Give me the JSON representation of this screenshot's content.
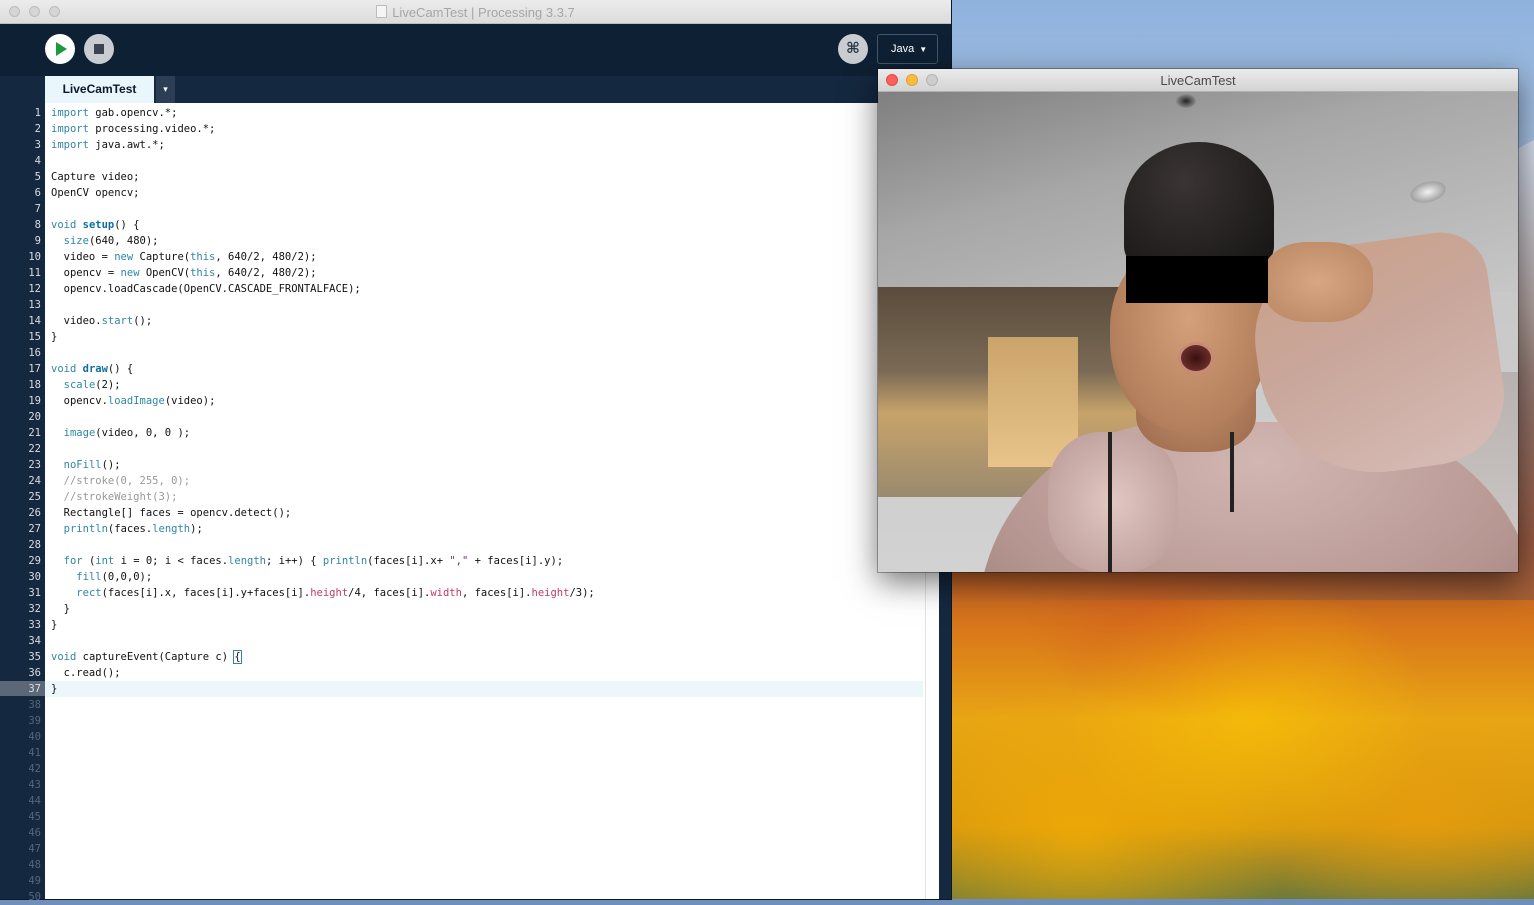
{
  "ide": {
    "window_title": "LiveCamTest | Processing 3.3.7",
    "mode": "Java",
    "debug_glyph": "⌘",
    "tab_label": "LiveCamTest",
    "tab_menu_glyph": "▾",
    "current_line": 37,
    "line_count": 50,
    "code_lines": [
      [
        {
          "t": "import",
          "c": "kw"
        },
        {
          "t": " gab.opencv.*;"
        }
      ],
      [
        {
          "t": "import",
          "c": "kw"
        },
        {
          "t": " processing.video.*;"
        }
      ],
      [
        {
          "t": "import",
          "c": "kw"
        },
        {
          "t": " java.awt.*;"
        }
      ],
      [],
      [
        {
          "t": "Capture video;"
        }
      ],
      [
        {
          "t": "OpenCV opencv;"
        }
      ],
      [],
      [
        {
          "t": "void",
          "c": "kw"
        },
        {
          "t": " "
        },
        {
          "t": "setup",
          "c": "fn"
        },
        {
          "t": "() {"
        }
      ],
      [
        {
          "t": "  "
        },
        {
          "t": "size",
          "c": "kw"
        },
        {
          "t": "(640, 480);"
        }
      ],
      [
        {
          "t": "  video = "
        },
        {
          "t": "new",
          "c": "kw"
        },
        {
          "t": " Capture("
        },
        {
          "t": "this",
          "c": "gn"
        },
        {
          "t": ", 640/2, 480/2);"
        }
      ],
      [
        {
          "t": "  opencv = "
        },
        {
          "t": "new",
          "c": "kw"
        },
        {
          "t": " OpenCV("
        },
        {
          "t": "this",
          "c": "gn"
        },
        {
          "t": ", 640/2, 480/2);"
        }
      ],
      [
        {
          "t": "  opencv.loadCascade(OpenCV.CASCADE_FRONTALFACE);"
        }
      ],
      [],
      [
        {
          "t": "  video."
        },
        {
          "t": "start",
          "c": "kw"
        },
        {
          "t": "();"
        }
      ],
      [
        {
          "t": "}"
        }
      ],
      [],
      [
        {
          "t": "void",
          "c": "kw"
        },
        {
          "t": " "
        },
        {
          "t": "draw",
          "c": "fn"
        },
        {
          "t": "() {"
        }
      ],
      [
        {
          "t": "  "
        },
        {
          "t": "scale",
          "c": "kw"
        },
        {
          "t": "(2);"
        }
      ],
      [
        {
          "t": "  opencv."
        },
        {
          "t": "loadImage",
          "c": "kw"
        },
        {
          "t": "(video);"
        }
      ],
      [],
      [
        {
          "t": "  "
        },
        {
          "t": "image",
          "c": "kw"
        },
        {
          "t": "(video, 0, 0 );"
        }
      ],
      [],
      [
        {
          "t": "  "
        },
        {
          "t": "noFill",
          "c": "kw"
        },
        {
          "t": "();"
        }
      ],
      [
        {
          "t": "  //stroke(0, 255, 0);",
          "c": "gr"
        }
      ],
      [
        {
          "t": "  //strokeWeight(3);",
          "c": "gr"
        }
      ],
      [
        {
          "t": "  Rectangle[] faces = opencv.detect();"
        }
      ],
      [
        {
          "t": "  "
        },
        {
          "t": "println",
          "c": "kw"
        },
        {
          "t": "(faces."
        },
        {
          "t": "length",
          "c": "kw"
        },
        {
          "t": ");"
        }
      ],
      [],
      [
        {
          "t": "  "
        },
        {
          "t": "for",
          "c": "kw"
        },
        {
          "t": " ("
        },
        {
          "t": "int",
          "c": "kw"
        },
        {
          "t": " i = 0; i < faces."
        },
        {
          "t": "length",
          "c": "kw"
        },
        {
          "t": "; i++) { "
        },
        {
          "t": "println",
          "c": "kw"
        },
        {
          "t": "(faces[i].x+ "
        },
        {
          "t": "\",\"",
          "c": "str"
        },
        {
          "t": " + faces[i].y);"
        }
      ],
      [
        {
          "t": "    "
        },
        {
          "t": "fill",
          "c": "kw"
        },
        {
          "t": "(0,0,0);"
        }
      ],
      [
        {
          "t": "    "
        },
        {
          "t": "rect",
          "c": "kw"
        },
        {
          "t": "(faces[i].x, faces[i].y+faces[i]."
        },
        {
          "t": "height",
          "c": "pk"
        },
        {
          "t": "/4, faces[i]."
        },
        {
          "t": "width",
          "c": "pk"
        },
        {
          "t": ", faces[i]."
        },
        {
          "t": "height",
          "c": "pk"
        },
        {
          "t": "/3);"
        }
      ],
      [
        {
          "t": "  }"
        }
      ],
      [
        {
          "t": "}"
        }
      ],
      [],
      [
        {
          "t": "void",
          "c": "kw"
        },
        {
          "t": " captureEvent(Capture c) "
        },
        {
          "t": "{",
          "c": "cur"
        }
      ],
      [
        {
          "t": "  c.read();"
        }
      ],
      [
        {
          "t": "}"
        }
      ]
    ]
  },
  "sketch": {
    "window_title": "LiveCamTest"
  },
  "colors": {
    "ide_background": "#14283f",
    "keyword": "#2f86a4",
    "run_green": "#1c9a3d",
    "close_red": "#fc605c",
    "minimize_yellow": "#fdbc40"
  }
}
